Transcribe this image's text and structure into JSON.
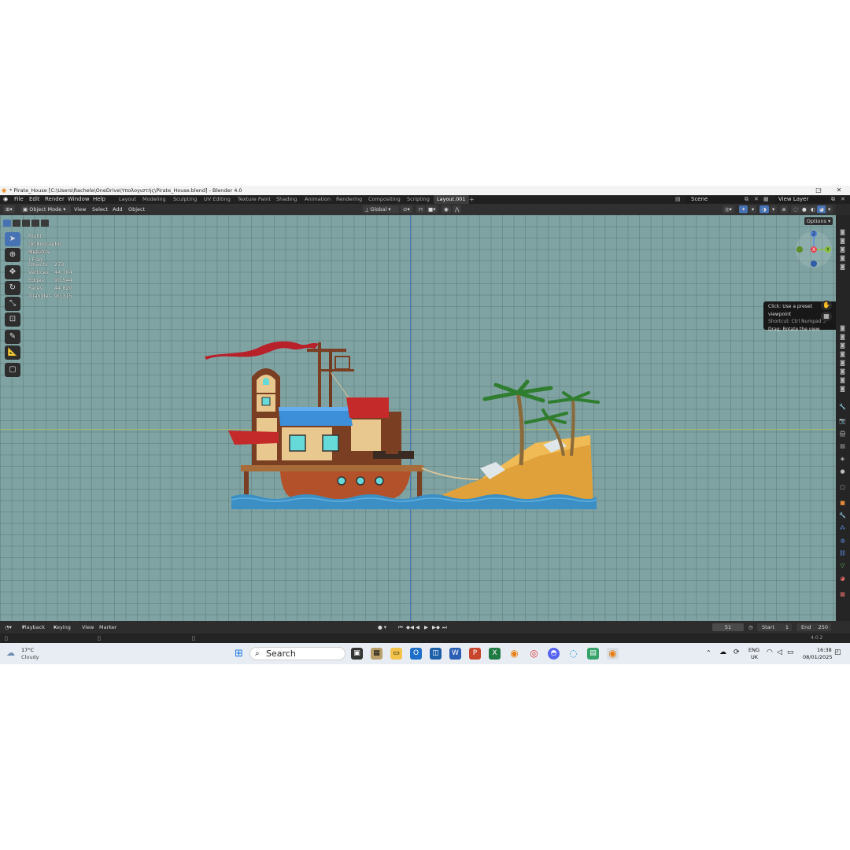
{
  "window": {
    "title": "* Pirate_House [C:\\Users\\Rachele\\OneDrive\\Υπολογιστής\\Pirate_House.blend] - Blender 4.0"
  },
  "menu": [
    "File",
    "Edit",
    "Render",
    "Window",
    "Help"
  ],
  "workspaces": [
    {
      "label": "Layout",
      "active": false
    },
    {
      "label": "Modeling",
      "active": false
    },
    {
      "label": "Sculpting",
      "active": false
    },
    {
      "label": "UV Editing",
      "active": false
    },
    {
      "label": "Texture Paint",
      "active": false
    },
    {
      "label": "Shading",
      "active": false
    },
    {
      "label": "Animation",
      "active": false
    },
    {
      "label": "Rendering",
      "active": false
    },
    {
      "label": "Compositing",
      "active": false
    },
    {
      "label": "Scripting",
      "active": false
    },
    {
      "label": "Layout.001",
      "active": true
    }
  ],
  "scene": {
    "label": "Scene"
  },
  "view_layer": {
    "label": "View Layer"
  },
  "header": {
    "mode": "Object Mode",
    "view": "View",
    "select": "Select",
    "add": "Add",
    "object": "Object",
    "transform": "Global",
    "options": "Options"
  },
  "viewport": {
    "view_name": "Right Orthographic",
    "collection": "(51) корабль | Flag",
    "units": "Meters",
    "stats": [
      {
        "label": "Objects",
        "value": "273"
      },
      {
        "label": "Vertices",
        "value": "44,704"
      },
      {
        "label": "Edges",
        "value": "90,544"
      },
      {
        "label": "Faces",
        "value": "44,820"
      },
      {
        "label": "Triangles",
        "value": "90,315"
      }
    ],
    "tooltip": [
      "Click: Use a preset viewpoint",
      "Shortcut: Ctrl Numpad 3",
      "Drag: Rotate the view"
    ],
    "gizmo": {
      "z": "Z",
      "x": "X",
      "y": "Y"
    }
  },
  "timeline": {
    "playback": "Playback",
    "keying": "Keying",
    "view": "View",
    "marker": "Marker",
    "current_frame": "51",
    "start_label": "Start",
    "start": "1",
    "end_label": "End",
    "end": "250"
  },
  "status": {
    "version": "4.0.2"
  },
  "taskbar": {
    "weather_temp": "17°C",
    "weather_desc": "Cloudy",
    "search": "Search",
    "lang": "ENG",
    "region": "UK",
    "time": "16:38",
    "date": "08/01/2025"
  },
  "colors": {
    "viewport_bg": "#7fa3a2",
    "active_tool": "#4772b3",
    "flag": "#b8202a",
    "water": "#3c8fc4",
    "sand": "#e0a13a"
  }
}
